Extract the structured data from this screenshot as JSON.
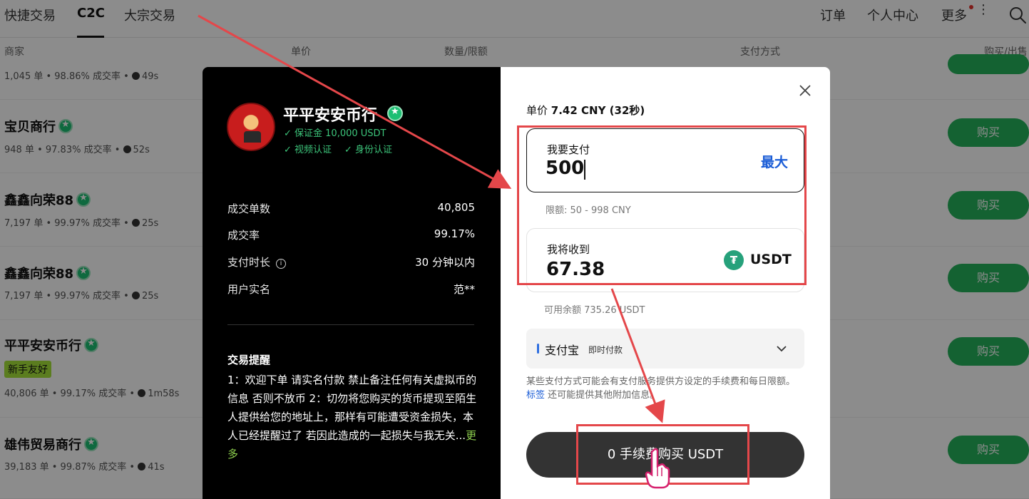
{
  "nav": {
    "tabs": [
      "快捷交易",
      "C2C",
      "大宗交易"
    ],
    "right": [
      "订单",
      "个人中心",
      "更多"
    ]
  },
  "columns": {
    "merchant": "商家",
    "price": "单价",
    "amount": "数量/限额",
    "payment": "支付方式",
    "action": "购买/出售"
  },
  "merchants": [
    {
      "name": "",
      "stats": "1,045 单 • 98.86% 成交率 •",
      "time": "49s"
    },
    {
      "name": "宝贝商行",
      "stats": "948 单 • 97.83% 成交率 •",
      "time": "52s"
    },
    {
      "name": "鑫鑫向荣88",
      "stats": "7,197 单 • 99.97% 成交率 •",
      "time": "25s"
    },
    {
      "name": "鑫鑫向荣88",
      "stats": "7,197 单 • 99.97% 成交率 •",
      "time": "25s"
    },
    {
      "name": "平平安安币行",
      "tag": "新手友好",
      "stats": "40,806 单 • 99.17% 成交率 •",
      "time": "1m58s"
    },
    {
      "name": "雄伟贸易商行",
      "stats": "39,183 单 • 99.87% 成交率 •",
      "time": "41s"
    }
  ],
  "buy_label": "购买",
  "seller": {
    "name": "平平安安币行",
    "deposit": "✓ 保证金 10,000 USDT",
    "video": "✓ 视频认证",
    "identity": "✓ 身份认证"
  },
  "stats": [
    {
      "label": "成交单数",
      "value": "40,805"
    },
    {
      "label": "成交率",
      "value": "99.17%"
    },
    {
      "label": "支付时长",
      "value": "30 分钟以内"
    },
    {
      "label": "用户实名",
      "value": "范**"
    }
  ],
  "reminder": {
    "title": "交易提醒",
    "text": "1：欢迎下单 请实名付款 禁止备注任何有关虚拟币的信息 否则不放币 2：切勿将您购买的货币提现至陌生人提供给您的地址上，那样有可能遭受资金损失，本人已经提醒过了 若因此造成的一起损失与我无关...",
    "more": "更多"
  },
  "order": {
    "price_label": "单价",
    "price_value": "7.42 CNY (32秒)",
    "pay_label": "我要支付",
    "pay_value": "500",
    "max": "最大",
    "limit": "限额: 50 - 998 CNY",
    "receive_label": "我将收到",
    "receive_value": "67.38",
    "currency": "USDT",
    "balance": "可用余额 735.26 USDT",
    "payment_method": "支付宝",
    "payment_sub": "即时付款",
    "note_before": "某些支付方式可能会有支付服务提供方设定的手续费和每日限额。",
    "note_link": "标签",
    "note_after": " 还可能提供其他附加信息。",
    "confirm": "0 手续费购买 USDT"
  },
  "colors": {
    "buy_green": "#26b35c",
    "verify_green": "#3cc47a",
    "link_blue": "#1a5cd6",
    "annotation_red": "#e4474a"
  }
}
